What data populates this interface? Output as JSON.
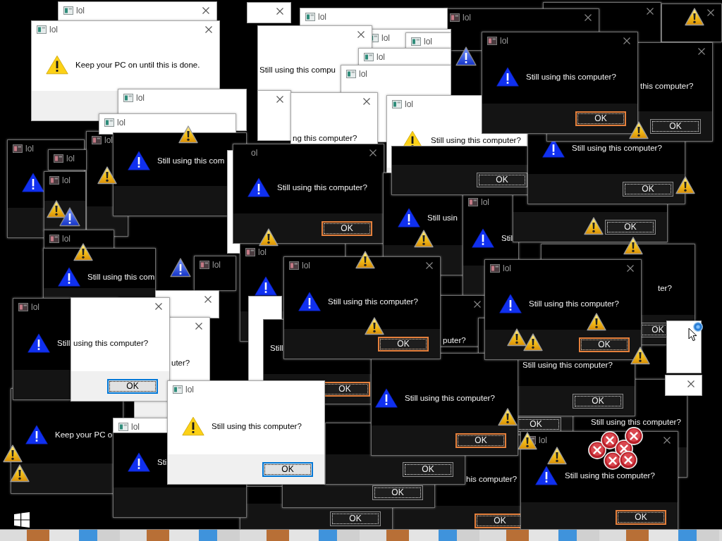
{
  "dialogs": [
    {
      "kind": "light",
      "title": "lol"
    },
    {
      "kind": "light"
    },
    {
      "kind": "dark"
    },
    {
      "kind": "dark"
    },
    {
      "kind": "light",
      "title": "lol"
    },
    {
      "kind": "dark",
      "title": "lol"
    },
    {
      "kind": "light",
      "title": "lol",
      "message": "Keep your PC on until this is done."
    },
    {
      "kind": "light",
      "title": "lol"
    },
    {
      "kind": "light",
      "title": "lol"
    },
    {
      "kind": "light",
      "title": "lol"
    },
    {
      "kind": "light",
      "message": "Still using this compu"
    },
    {
      "kind": "light",
      "title": "lol"
    },
    {
      "kind": "light",
      "title": "lol"
    },
    {
      "kind": "light"
    },
    {
      "kind": "light",
      "title": "lol"
    },
    {
      "kind": "light",
      "title": "lol",
      "message": "Still using this computer?"
    },
    {
      "kind": "dark",
      "title": "lol",
      "message": "Still using this computer?",
      "button": {
        "label": "OK",
        "focused": true
      }
    },
    {
      "kind": "dark",
      "message": "this computer?",
      "button": {
        "label": "OK",
        "focused": false
      }
    },
    {
      "kind": "dark",
      "title": "lol"
    },
    {
      "kind": "dark",
      "title": "lol"
    },
    {
      "kind": "light",
      "message": "ng this computer?"
    },
    {
      "kind": "dark",
      "title": "lol"
    },
    {
      "kind": "dark",
      "message": "Still using this com"
    },
    {
      "kind": "light"
    },
    {
      "kind": "dark",
      "title": "lol"
    },
    {
      "kind": "dark",
      "title": "ol",
      "message": "Still using this computer?",
      "button": {
        "label": "OK",
        "focused": true
      }
    },
    {
      "kind": "dark",
      "button": {
        "label": "OK",
        "focused": false
      }
    },
    {
      "kind": "dark",
      "message": "Still using this computer?",
      "button": {
        "label": "OK",
        "focused": false
      }
    },
    {
      "kind": "dark",
      "message": "Still usin"
    },
    {
      "kind": "dark",
      "title": "lol",
      "message": "Stil"
    },
    {
      "kind": "dark",
      "button": {
        "label": "OK",
        "focused": false
      }
    },
    {
      "kind": "dark",
      "title": "lol"
    },
    {
      "kind": "dark",
      "title": "lol"
    },
    {
      "kind": "dark",
      "title": "lol"
    },
    {
      "kind": "dark",
      "message": "Still using this com"
    },
    {
      "kind": "dark",
      "title": "lol",
      "message": "Still"
    },
    {
      "kind": "dark",
      "title": "lol",
      "message": "Still using this computer?",
      "button": {
        "label": "OK",
        "focused": true
      }
    },
    {
      "kind": "dark",
      "message": "puter?"
    },
    {
      "kind": "dark",
      "title": "lol",
      "message": "Still using this computer?",
      "button": {
        "label": "OK",
        "focused": true
      }
    },
    {
      "kind": "dark",
      "message": "ter?",
      "button": {
        "label": "OK",
        "focused": false
      }
    },
    {
      "kind": "light"
    },
    {
      "kind": "light"
    },
    {
      "kind": "light",
      "message": "using this computer?",
      "button": {
        "label": "OK",
        "focused": true
      }
    },
    {
      "kind": "light",
      "message": "uter?"
    },
    {
      "kind": "light"
    },
    {
      "kind": "dark",
      "message": "Still",
      "button": {
        "label": "OK",
        "focused": true
      }
    },
    {
      "kind": "dark",
      "message": "Keep your PC o"
    },
    {
      "kind": "light",
      "title": "lol"
    },
    {
      "kind": "light",
      "title": "lol",
      "message": "Still using this computer?",
      "button": {
        "label": "OK",
        "focused": true
      }
    },
    {
      "kind": "dark",
      "message": "Still using this computer?",
      "button": {
        "label": "OK",
        "focused": true
      }
    },
    {
      "kind": "dark",
      "message": "Still using this computer?",
      "button": {
        "label": "OK",
        "focused": false
      }
    },
    {
      "kind": "light"
    },
    {
      "kind": "dark",
      "button": {
        "label": "OK",
        "focused": false
      }
    },
    {
      "kind": "dark",
      "message": "Still using this computer?"
    },
    {
      "kind": "dark",
      "message": "Sti"
    },
    {
      "kind": "dark",
      "button": {
        "label": "OK",
        "focused": false
      }
    },
    {
      "kind": "dark",
      "button": {
        "label": "OK",
        "focused": false
      }
    },
    {
      "kind": "dark",
      "button": {
        "label": "OK",
        "focused": false
      }
    },
    {
      "kind": "dark",
      "message": "his computer?",
      "button": {
        "label": "OK",
        "focused": true
      }
    },
    {
      "kind": "dark",
      "title": "lol",
      "message": "Still using this computer?",
      "button": {
        "label": "OK",
        "focused": true
      }
    }
  ]
}
